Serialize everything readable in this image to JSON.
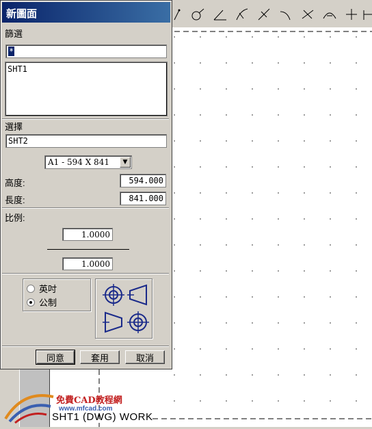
{
  "dialog": {
    "title": "新圖面",
    "filter_label": "篩選",
    "filter_value": "*",
    "sheet_list": [
      "SHT1"
    ],
    "select_label": "選擇",
    "select_value": "SHT2",
    "size_selected": "A1 - 594 X 841",
    "height_label": "高度:",
    "height_value": "594.000",
    "length_label": "長度:",
    "length_value": "841.000",
    "scale_label": "比例:",
    "scale_top": "1.0000",
    "scale_bottom": "1.0000",
    "unit_inch": "英吋",
    "unit_metric": "公制",
    "unit_selected": "公制",
    "projection_icons": [
      "first-angle-projection-icon",
      "third-angle-projection-icon"
    ],
    "buttons": {
      "ok": "同意",
      "apply": "套用",
      "cancel": "取消"
    }
  },
  "canvas": {
    "sheet_label": "SHT1 (DWG) WORK",
    "watermark_brand": "免費CAD教程網",
    "watermark_site": "www.mfcad.com"
  },
  "colors": {
    "titlebar": "#0a246a",
    "accent": "#3a6ea5",
    "icon_blue": "#1a2a8a"
  }
}
